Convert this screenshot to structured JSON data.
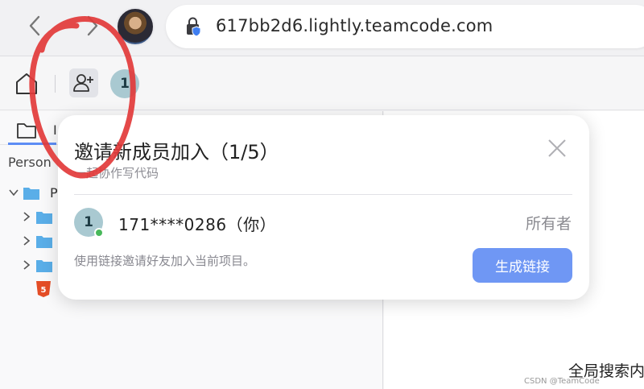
{
  "browser": {
    "url": "617bb2d6.lightly.teamcode.com",
    "icons": [
      "back-icon",
      "forward-icon",
      "lock-shield-icon"
    ]
  },
  "toolbar": {
    "icons": [
      "home-icon",
      "add-user-icon"
    ],
    "member_initial": "1"
  },
  "side_panel": {
    "tab_label": "I",
    "folder_label": "Person",
    "tree_root_label": "P",
    "icons": [
      "folder-icon",
      "chevron-down-icon",
      "chevron-right-icon",
      "html5-icon"
    ]
  },
  "editor": {
    "global_search_label": "全局搜索内",
    "watermark": "CSDN @TeamCode"
  },
  "invite_dialog": {
    "title": "邀请新成员加入（1/5）",
    "subtitle": "一起协作写代码",
    "member": {
      "initial": "1",
      "name": "171****0286（你）",
      "role": "所有者",
      "online": true
    },
    "hint": "使用链接邀请好友加入当前项目。",
    "generate_button_label": "生成链接",
    "close_icon": "close-icon"
  },
  "colors": {
    "accent_button": "#6f97f4",
    "online_dot": "#48b85a",
    "annotation_red": "#e23a3a",
    "tab_underline": "#5d8df5"
  }
}
